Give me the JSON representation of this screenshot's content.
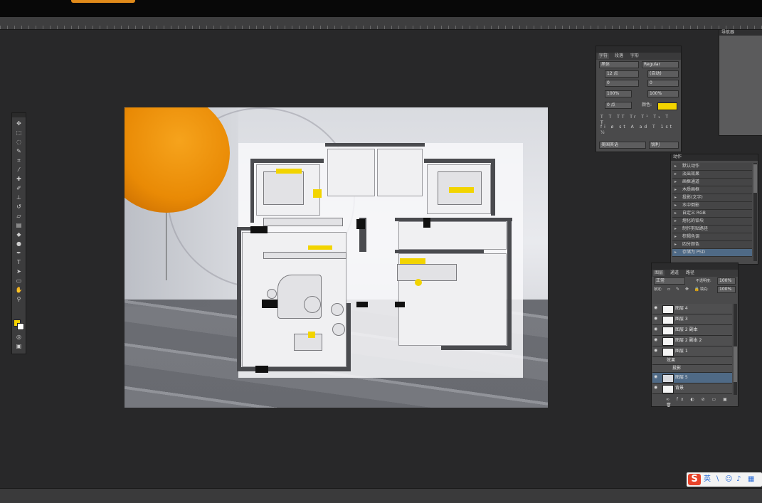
{
  "app": {
    "accent": "#f2d400",
    "balloon_color": "#e98a05",
    "workspace_bg": "#282829"
  },
  "toolbox": {
    "tools": [
      "move-tool",
      "marquee-tool",
      "lasso-tool",
      "quick-select-tool",
      "crop-tool",
      "eyedropper-tool",
      "healing-tool",
      "brush-tool",
      "clone-stamp-tool",
      "history-brush-tool",
      "eraser-tool",
      "gradient-tool",
      "blur-tool",
      "dodge-tool",
      "pen-tool",
      "type-tool",
      "path-select-tool",
      "shape-tool",
      "hand-tool",
      "zoom-tool"
    ],
    "foreground_color": "#f4d000",
    "background_color": "#ffffff"
  },
  "character_panel": {
    "tabs": [
      "字符",
      "段落",
      "字形"
    ],
    "font_family": "黑体",
    "font_style": "Regular",
    "font_size": "12 点",
    "leading": "(自动)",
    "kerning": "0",
    "tracking": "0",
    "vertical_scale": "100%",
    "horizontal_scale": "100%",
    "baseline_shift": "0 点",
    "color_label": "颜色:",
    "color": "#f2d400",
    "language": "美国英语",
    "antialias": "锐利"
  },
  "actions_panel": {
    "tab": "动作",
    "items": [
      "默认动作",
      "淡出效果",
      "画框通道",
      "木质画框",
      "投影(文字)",
      "水中倒影",
      "自定义 RGB",
      "熔化的铅块",
      "制作剪贴路径",
      "棕褐色调",
      "四分颜色",
      "存储为 PSD"
    ]
  },
  "layers_panel": {
    "tabs": [
      "图层",
      "通道",
      "路径"
    ],
    "blend_mode": "正常",
    "opacity_label": "不透明度:",
    "opacity": "100%",
    "lock_label": "锁定:",
    "fill_label": "填充:",
    "fill": "100%",
    "layers": [
      "图层 4",
      "图层 3",
      "图层 2 副本",
      "图层 2 副本 2",
      "图层 1",
      "效果",
      "投影",
      "图层 5",
      "背景"
    ],
    "selected_index": 7
  },
  "navigator": {
    "tab": "导航器"
  },
  "ime": {
    "logo": "S",
    "mode": "英",
    "icons": [
      "punct",
      "emoji",
      "mic",
      "keyboard"
    ]
  }
}
